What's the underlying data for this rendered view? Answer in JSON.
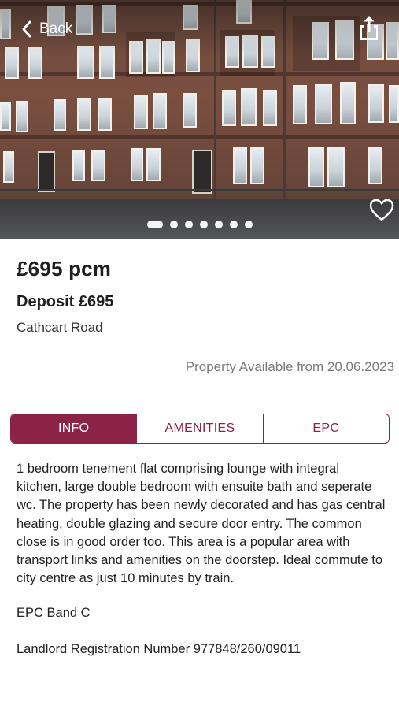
{
  "header": {
    "back_label": "Back",
    "back_icon": "chevron-left-icon",
    "share_icon": "share-icon",
    "favorite_icon": "heart-icon"
  },
  "gallery": {
    "image_count": 7,
    "active_index": 0
  },
  "listing": {
    "price": "£695 pcm",
    "deposit": "Deposit £695",
    "address": "Cathcart Road",
    "availability": "Property Available from 20.06.2023"
  },
  "tabs": [
    {
      "label": "INFO",
      "active": true
    },
    {
      "label": "AMENITIES",
      "active": false
    },
    {
      "label": "EPC",
      "active": false
    }
  ],
  "info": {
    "description": "1 bedroom tenement flat comprising lounge with integral kitchen, large double bedroom with ensuite bath and seperate wc. The property has been newly decorated and has gas central heating, double glazing and secure door entry. The common close is in good order too. This area is a popular area with transport links and amenities on the doorstep. Ideal commute to city centre as just 10 minutes by train.",
    "epc_band": "EPC Band C",
    "landlord_registration": "Landlord Registration Number 977848/260/09011"
  },
  "colors": {
    "accent": "#8a2346",
    "muted_text": "#7a7a7a"
  }
}
